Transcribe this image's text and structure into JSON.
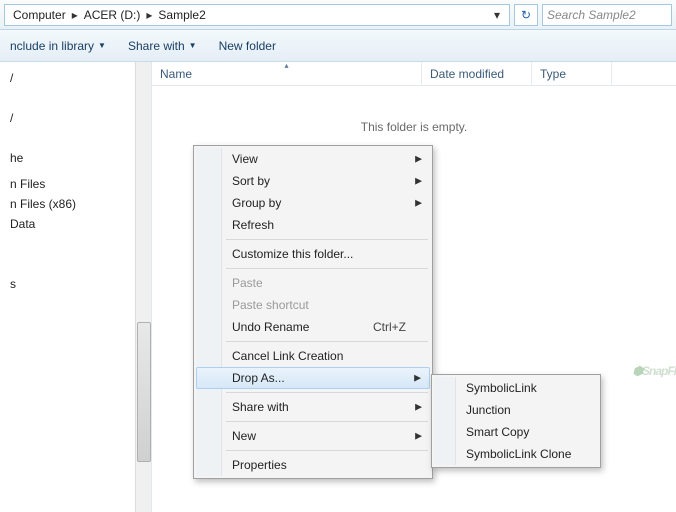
{
  "breadcrumb": {
    "p0": "Computer",
    "p1": "ACER (D:)",
    "p2": "Sample2"
  },
  "search": {
    "placeholder": "Search Sample2"
  },
  "toolbar": {
    "include": "nclude in library",
    "share": "Share with",
    "newfolder": "New folder"
  },
  "columns": {
    "name": "Name",
    "date": "Date modified",
    "type": "Type"
  },
  "empty": "This folder is empty.",
  "sidebar": {
    "i0": "/",
    "i1": "/",
    "i2": "he",
    "i3": "",
    "i4": "n Files",
    "i5": "n Files (x86)",
    "i6": "Data",
    "i7": "",
    "i8": "s"
  },
  "ctx": {
    "view": "View",
    "sortby": "Sort by",
    "groupby": "Group by",
    "refresh": "Refresh",
    "customize": "Customize this folder...",
    "paste": "Paste",
    "pastesc": "Paste shortcut",
    "undo": "Undo Rename",
    "undokey": "Ctrl+Z",
    "cancel": "Cancel Link Creation",
    "dropas": "Drop As...",
    "sharewith": "Share with",
    "new": "New",
    "properties": "Properties"
  },
  "fly": {
    "sym": "SymbolicLink",
    "jun": "Junction",
    "smart": "Smart Copy",
    "clone": "SymbolicLink Clone"
  },
  "watermark": "SnapFi"
}
